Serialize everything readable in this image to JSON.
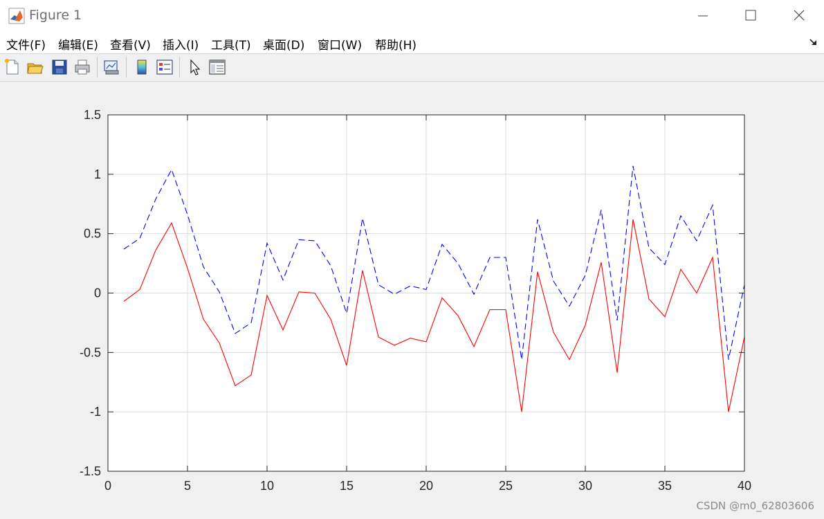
{
  "window": {
    "title": "Figure 1",
    "controls": [
      "minimize",
      "maximize",
      "close"
    ]
  },
  "menubar": {
    "items": [
      "文件(F)",
      "编辑(E)",
      "查看(V)",
      "插入(I)",
      "工具(T)",
      "桌面(D)",
      "窗口(W)",
      "帮助(H)"
    ]
  },
  "toolbar": {
    "icons": [
      "new-figure-icon",
      "open-file-icon",
      "save-icon",
      "print-icon",
      "link-plot-icon",
      "insert-colorbar-icon",
      "insert-legend-icon",
      "edit-plot-icon",
      "property-inspector-icon"
    ]
  },
  "watermark": "CSDN @m0_62803606",
  "chart_data": {
    "type": "line",
    "title": "",
    "xlabel": "",
    "ylabel": "",
    "xlim": [
      0,
      40
    ],
    "ylim": [
      -1.5,
      1.5
    ],
    "xticks": [
      0,
      5,
      10,
      15,
      20,
      25,
      30,
      35,
      40
    ],
    "xtick_labels": [
      "0",
      "5",
      "10",
      "15",
      "20",
      "25",
      "30",
      "35",
      "40"
    ],
    "yticks": [
      -1.5,
      -1,
      -0.5,
      0,
      0.5,
      1,
      1.5
    ],
    "ytick_labels": [
      "-1.5",
      "-1",
      "-0.5",
      "0",
      "0.5",
      "1",
      "1.5"
    ],
    "grid": true,
    "x": [
      1,
      2,
      3,
      4,
      5,
      6,
      7,
      8,
      9,
      10,
      11,
      12,
      13,
      14,
      15,
      16,
      17,
      18,
      19,
      20,
      21,
      22,
      23,
      24,
      25,
      26,
      27,
      28,
      29,
      30,
      31,
      32,
      33,
      34,
      35,
      36,
      37,
      38,
      39,
      40
    ],
    "series": [
      {
        "color": "#ff0000",
        "style": "solid",
        "values": [
          -0.07,
          0.03,
          0.36,
          0.59,
          0.21,
          -0.22,
          -0.42,
          -0.78,
          -0.69,
          -0.02,
          -0.31,
          0.01,
          0.0,
          -0.22,
          -0.61,
          0.19,
          -0.37,
          -0.44,
          -0.38,
          -0.41,
          -0.04,
          -0.19,
          -0.45,
          -0.14,
          -0.14,
          -1.0,
          0.18,
          -0.33,
          -0.56,
          -0.27,
          0.26,
          -0.67,
          0.62,
          -0.05,
          -0.2,
          0.2,
          0.0,
          0.3,
          -1.0,
          -0.37
        ]
      },
      {
        "color": "#0000ff",
        "style": "dashed",
        "values": [
          0.37,
          0.46,
          0.79,
          1.04,
          0.66,
          0.22,
          0.01,
          -0.34,
          -0.25,
          0.42,
          0.11,
          0.45,
          0.44,
          0.23,
          -0.17,
          0.63,
          0.07,
          -0.01,
          0.06,
          0.03,
          0.41,
          0.25,
          -0.01,
          0.3,
          0.3,
          -0.56,
          0.62,
          0.1,
          -0.11,
          0.15,
          0.7,
          -0.23,
          1.07,
          0.38,
          0.24,
          0.65,
          0.44,
          0.74,
          -0.56,
          0.07
        ]
      }
    ]
  }
}
